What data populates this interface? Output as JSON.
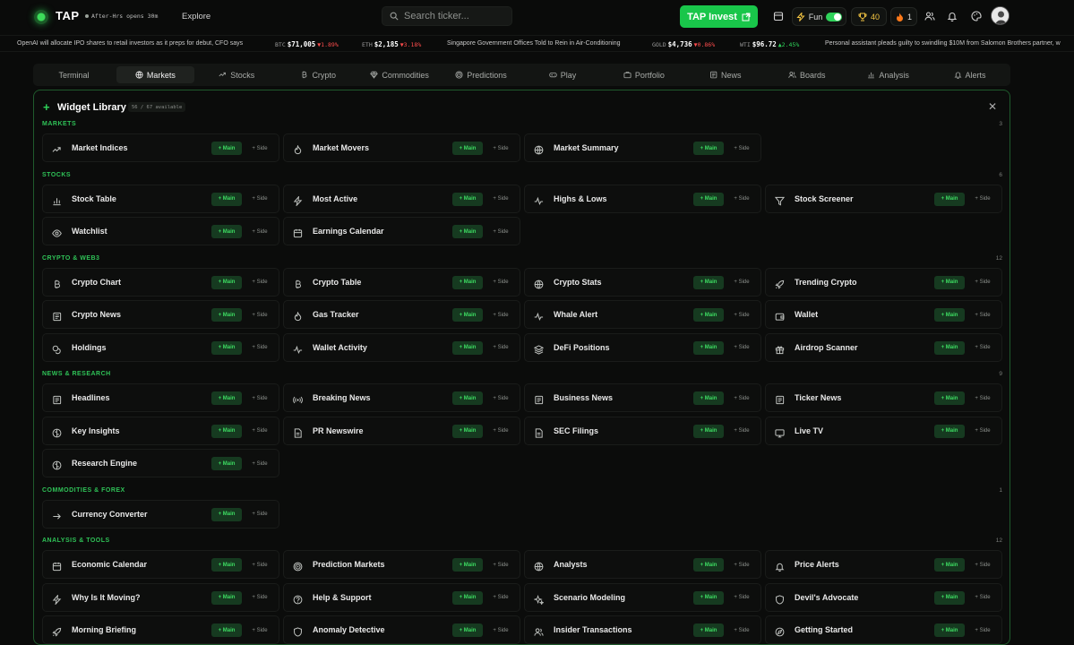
{
  "app": {
    "name": "TAP",
    "status": "After-Hrs opens 30m",
    "explore": "Explore"
  },
  "search": {
    "placeholder": "Search ticker..."
  },
  "invest": {
    "label": "TAP Invest"
  },
  "fun": {
    "label": "Fun"
  },
  "trophy": {
    "count": "40"
  },
  "streak": {
    "count": "1"
  },
  "ticker": [
    {
      "kind": "news",
      "text": "OpenAI will allocate IPO shares to retail investors as it preps for debut, CFO says"
    },
    {
      "kind": "quote",
      "sym": "BTC",
      "val": "$71,005",
      "chg": "▼1.89%",
      "dir": "neg"
    },
    {
      "kind": "quote",
      "sym": "ETH",
      "val": "$2,185",
      "chg": "▼3.18%",
      "dir": "neg"
    },
    {
      "kind": "news",
      "text": "Singapore Government Offices Told to Rein in Air-Conditioning"
    },
    {
      "kind": "quote",
      "sym": "GOLD",
      "val": "$4,736",
      "chg": "▼0.86%",
      "dir": "neg"
    },
    {
      "kind": "quote",
      "sym": "WTI",
      "val": "$96.72",
      "chg": "▲2.45%",
      "dir": "pos"
    },
    {
      "kind": "news",
      "text": "Personal assistant pleads guilty to swindling $10M from Salomon Brothers partner, w"
    }
  ],
  "tabs": [
    "Terminal",
    "Markets",
    "Stocks",
    "Crypto",
    "Commodities",
    "Predictions",
    "Play",
    "Portfolio",
    "News",
    "Boards",
    "Analysis",
    "Alerts"
  ],
  "tab_icons": [
    "",
    "globe-icon",
    "trend-icon",
    "bitcoin-icon",
    "gem-icon",
    "target-icon",
    "gamepad-icon",
    "briefcase-icon",
    "newspaper-icon",
    "users-icon",
    "bar-chart-icon",
    "bell-icon"
  ],
  "active_tab": "Markets",
  "library": {
    "title": "Widget Library",
    "count": "56 / 67 available",
    "main_label": "+ Main",
    "side_label": "+ Side"
  },
  "sections": [
    {
      "title": "MARKETS",
      "count": "3",
      "widgets": [
        {
          "label": "Market Indices",
          "icon": "trend-icon"
        },
        {
          "label": "Market Movers",
          "icon": "flame-icon"
        },
        {
          "label": "Market Summary",
          "icon": "globe-icon"
        }
      ]
    },
    {
      "title": "STOCKS",
      "count": "6",
      "widgets": [
        {
          "label": "Stock Table",
          "icon": "bar-chart-icon"
        },
        {
          "label": "Most Active",
          "icon": "zap-icon"
        },
        {
          "label": "Highs & Lows",
          "icon": "activity-icon"
        },
        {
          "label": "Stock Screener",
          "icon": "filter-icon"
        },
        {
          "label": "Watchlist",
          "icon": "eye-icon"
        },
        {
          "label": "Earnings Calendar",
          "icon": "calendar-icon"
        }
      ]
    },
    {
      "title": "CRYPTO & WEB3",
      "count": "12",
      "widgets": [
        {
          "label": "Crypto Chart",
          "icon": "bitcoin-icon"
        },
        {
          "label": "Crypto Table",
          "icon": "bitcoin-icon"
        },
        {
          "label": "Crypto Stats",
          "icon": "globe-icon"
        },
        {
          "label": "Trending Crypto",
          "icon": "rocket-icon"
        },
        {
          "label": "Crypto News",
          "icon": "newspaper-icon"
        },
        {
          "label": "Gas Tracker",
          "icon": "flame-icon"
        },
        {
          "label": "Whale Alert",
          "icon": "activity-icon"
        },
        {
          "label": "Wallet",
          "icon": "wallet-icon"
        },
        {
          "label": "Holdings",
          "icon": "coins-icon"
        },
        {
          "label": "Wallet Activity",
          "icon": "activity-icon"
        },
        {
          "label": "DeFi Positions",
          "icon": "layers-icon"
        },
        {
          "label": "Airdrop Scanner",
          "icon": "gift-icon"
        }
      ]
    },
    {
      "title": "NEWS & RESEARCH",
      "count": "9",
      "widgets": [
        {
          "label": "Headlines",
          "icon": "newspaper-icon"
        },
        {
          "label": "Breaking News",
          "icon": "radio-icon"
        },
        {
          "label": "Business News",
          "icon": "newspaper-icon"
        },
        {
          "label": "Ticker News",
          "icon": "newspaper-icon"
        },
        {
          "label": "Key Insights",
          "icon": "brain-icon"
        },
        {
          "label": "PR Newswire",
          "icon": "file-icon"
        },
        {
          "label": "SEC Filings",
          "icon": "file-icon"
        },
        {
          "label": "Live TV",
          "icon": "tv-icon"
        },
        {
          "label": "Research Engine",
          "icon": "brain-icon"
        }
      ]
    },
    {
      "title": "COMMODITIES & FOREX",
      "count": "1",
      "widgets": [
        {
          "label": "Currency Converter",
          "icon": "arrow-right-icon"
        }
      ]
    },
    {
      "title": "ANALYSIS & TOOLS",
      "count": "12",
      "widgets": [
        {
          "label": "Economic Calendar",
          "icon": "calendar-icon"
        },
        {
          "label": "Prediction Markets",
          "icon": "target-icon"
        },
        {
          "label": "Analysts",
          "icon": "globe-icon"
        },
        {
          "label": "Price Alerts",
          "icon": "bell-icon"
        },
        {
          "label": "Why Is It Moving?",
          "icon": "zap-icon"
        },
        {
          "label": "Help & Support",
          "icon": "help-icon"
        },
        {
          "label": "Scenario Modeling",
          "icon": "sparkles-icon"
        },
        {
          "label": "Devil's Advocate",
          "icon": "shield-icon"
        },
        {
          "label": "Morning Briefing",
          "icon": "rocket-icon"
        },
        {
          "label": "Anomaly Detective",
          "icon": "shield-icon"
        },
        {
          "label": "Insider Transactions",
          "icon": "users-icon"
        },
        {
          "label": "Getting Started",
          "icon": "compass-icon"
        }
      ]
    }
  ]
}
